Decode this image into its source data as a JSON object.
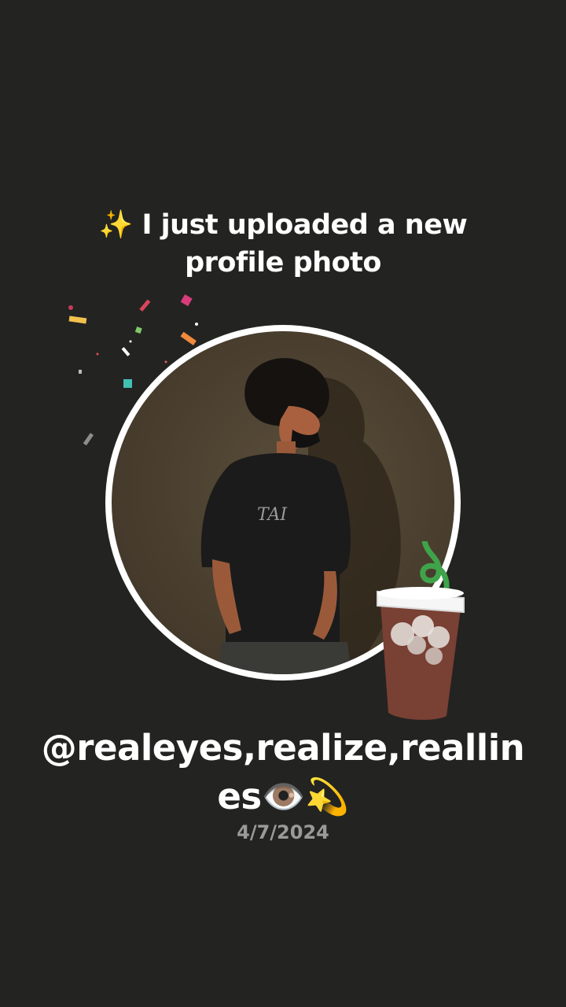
{
  "announcement": {
    "headline": "✨ I just uploaded a new profile photo"
  },
  "profile": {
    "username": "@realeyes,realize,reallines👁️💫",
    "date": "4/7/2024",
    "shirt_text": "TAI"
  },
  "colors": {
    "background": "#232321",
    "headline_text": "#ffffff",
    "date_text": "#9a9a9a",
    "avatar_ring": "#ffffff"
  },
  "icons": {
    "sparkles": "sparkles-emoji",
    "eye": "eye-emoji",
    "dizzy": "dizzy-emoji",
    "decoration": "iced-drink-sticker"
  }
}
